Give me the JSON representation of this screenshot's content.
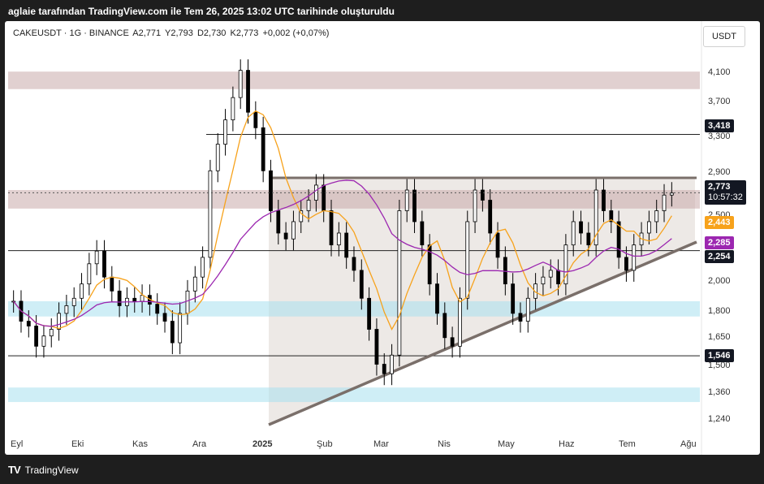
{
  "header": {
    "title": "aglaie tarafından TradingView.com ile Tem 26, 2025 13:02 UTC tarihinde oluşturuldu"
  },
  "symbol": {
    "name": "CAKEUSDT · 1G · BINANCE",
    "open": "A2,771",
    "high": "Y2,793",
    "low": "D2,730",
    "close": "K2,773",
    "change": "+0,002 (+0,07%)"
  },
  "currency": "USDT",
  "price_axis": [
    "4,100",
    "3,700",
    "3,300",
    "2,900",
    "2,500",
    "2,000",
    "1,800",
    "1,650",
    "1,500",
    "1,360",
    "1,240"
  ],
  "tags": {
    "level_3418": "3,418",
    "current_price": "2,773",
    "countdown": "10:57:32",
    "ma_orange": "2,443",
    "ma_purple": "2,285",
    "level_2254": "2,254",
    "level_1546": "1,546"
  },
  "time_axis": [
    "Eyl",
    "Eki",
    "Kas",
    "Ara",
    "2025",
    "Şub",
    "Mar",
    "Nis",
    "May",
    "Haz",
    "Tem",
    "Ağu"
  ],
  "footer": {
    "brand": "TradingView",
    "logo_mark": "TV"
  },
  "colors": {
    "orange_ma": "#f7a21b",
    "purple_ma": "#9c27b0",
    "resistance_zone": "#c9a9a9",
    "support_zone": "#a8e0ee",
    "trendline": "#7a6f6a"
  },
  "chart_data": {
    "type": "candlestick",
    "symbol": "CAKEUSDT",
    "interval": "1G",
    "exchange": "BINANCE",
    "ohlc_last": {
      "open": 2.771,
      "high": 2.793,
      "low": 2.73,
      "close": 2.773
    },
    "y_scale": "log",
    "y_range": [
      1.18,
      4.7
    ],
    "horizontal_levels": [
      3.418,
      2.254,
      1.546
    ],
    "zones": [
      {
        "from": 4.02,
        "to": 4.28,
        "kind": "resistance"
      },
      {
        "from": 2.62,
        "to": 2.8,
        "kind": "resistance"
      },
      {
        "from": 1.78,
        "to": 1.88,
        "kind": "support"
      },
      {
        "from": 1.31,
        "to": 1.38,
        "kind": "support"
      }
    ],
    "current_price": 2.773,
    "moving_averages": [
      {
        "value": 2.443
      },
      {
        "value": 2.285
      }
    ],
    "closes": [
      1.88,
      1.75,
      1.72,
      1.6,
      1.66,
      1.7,
      1.8,
      1.85,
      1.9,
      2.0,
      2.15,
      2.25,
      2.05,
      1.95,
      1.85,
      1.9,
      1.88,
      1.92,
      1.86,
      1.8,
      1.75,
      1.62,
      1.8,
      1.95,
      2.05,
      2.2,
      3.0,
      3.3,
      3.6,
      3.9,
      4.3,
      3.7,
      3.5,
      3.0,
      2.6,
      2.4,
      2.35,
      2.5,
      2.6,
      2.7,
      2.85,
      2.6,
      2.3,
      2.4,
      2.2,
      2.1,
      1.9,
      1.7,
      1.5,
      1.45,
      1.55,
      2.6,
      2.8,
      2.5,
      2.3,
      2.0,
      1.8,
      1.65,
      1.6,
      1.9,
      2.5,
      2.8,
      2.7,
      2.4,
      2.2,
      2.0,
      1.8,
      1.75,
      1.9,
      2.0,
      2.05,
      2.1,
      2.0,
      2.3,
      2.5,
      2.4,
      2.3,
      2.8,
      2.6,
      2.5,
      2.2,
      2.1,
      2.3,
      2.4,
      2.5,
      2.6,
      2.75,
      2.77
    ]
  }
}
